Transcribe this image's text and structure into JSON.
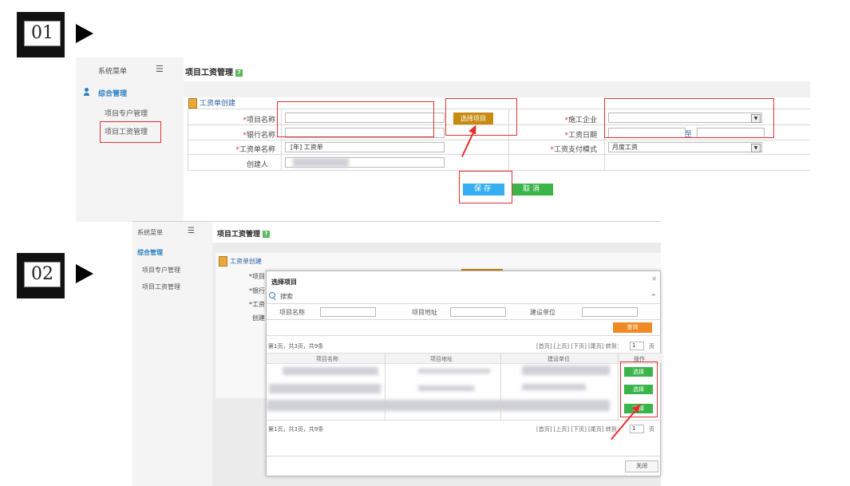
{
  "steps": {
    "one": "01",
    "two": "02"
  },
  "shot1": {
    "sidebar": {
      "title": "系统菜单",
      "menu_toggle": "☰",
      "group": "综合管理",
      "items": [
        "项目专户管理",
        "项目工资管理"
      ]
    },
    "page_title": "项目工资管理",
    "help_mark": "?",
    "tab": "工资单创建",
    "form": {
      "project_name_label": "项目名称",
      "bank_name_label": "银行名称",
      "payroll_name_label": "工资单名称",
      "creator_label": "创建人",
      "select_project_button": "选择项目",
      "company_label": "施工企业",
      "wage_date_label": "工资日期",
      "date_separator": "至",
      "pay_mode_label": "工资支付模式",
      "payroll_name_value": "[年] 工资单",
      "pay_mode_value": "月度工资",
      "required_mark": "*"
    },
    "save_button": "保存",
    "cancel_button": "取消"
  },
  "shot2": {
    "sidebar": {
      "title": "系统菜单",
      "menu_toggle": "☰",
      "group": "综合管理",
      "items": [
        "项目专户管理",
        "项目工资管理"
      ]
    },
    "page_title": "项目工资管理",
    "tab": "工资单创建",
    "bg_labels": [
      "*项目",
      "*银行",
      "*工资",
      "创建"
    ],
    "modal": {
      "title": "选择项目",
      "close": "×",
      "search_label": "搜索",
      "collapse": "⌃",
      "fields": [
        "项目名称",
        "项目地址",
        "建设单位"
      ],
      "query_button": "查询",
      "pager_text": "第1页，共3页，共9条",
      "pager_links": "[首页] [上页] [下页] [尾页] 转到：",
      "pager_page": "1",
      "pager_suffix": "页",
      "columns": [
        "项目名称",
        "项目地址",
        "建设单位",
        "操作"
      ],
      "row_button": "选择",
      "close_button": "关闭"
    }
  }
}
